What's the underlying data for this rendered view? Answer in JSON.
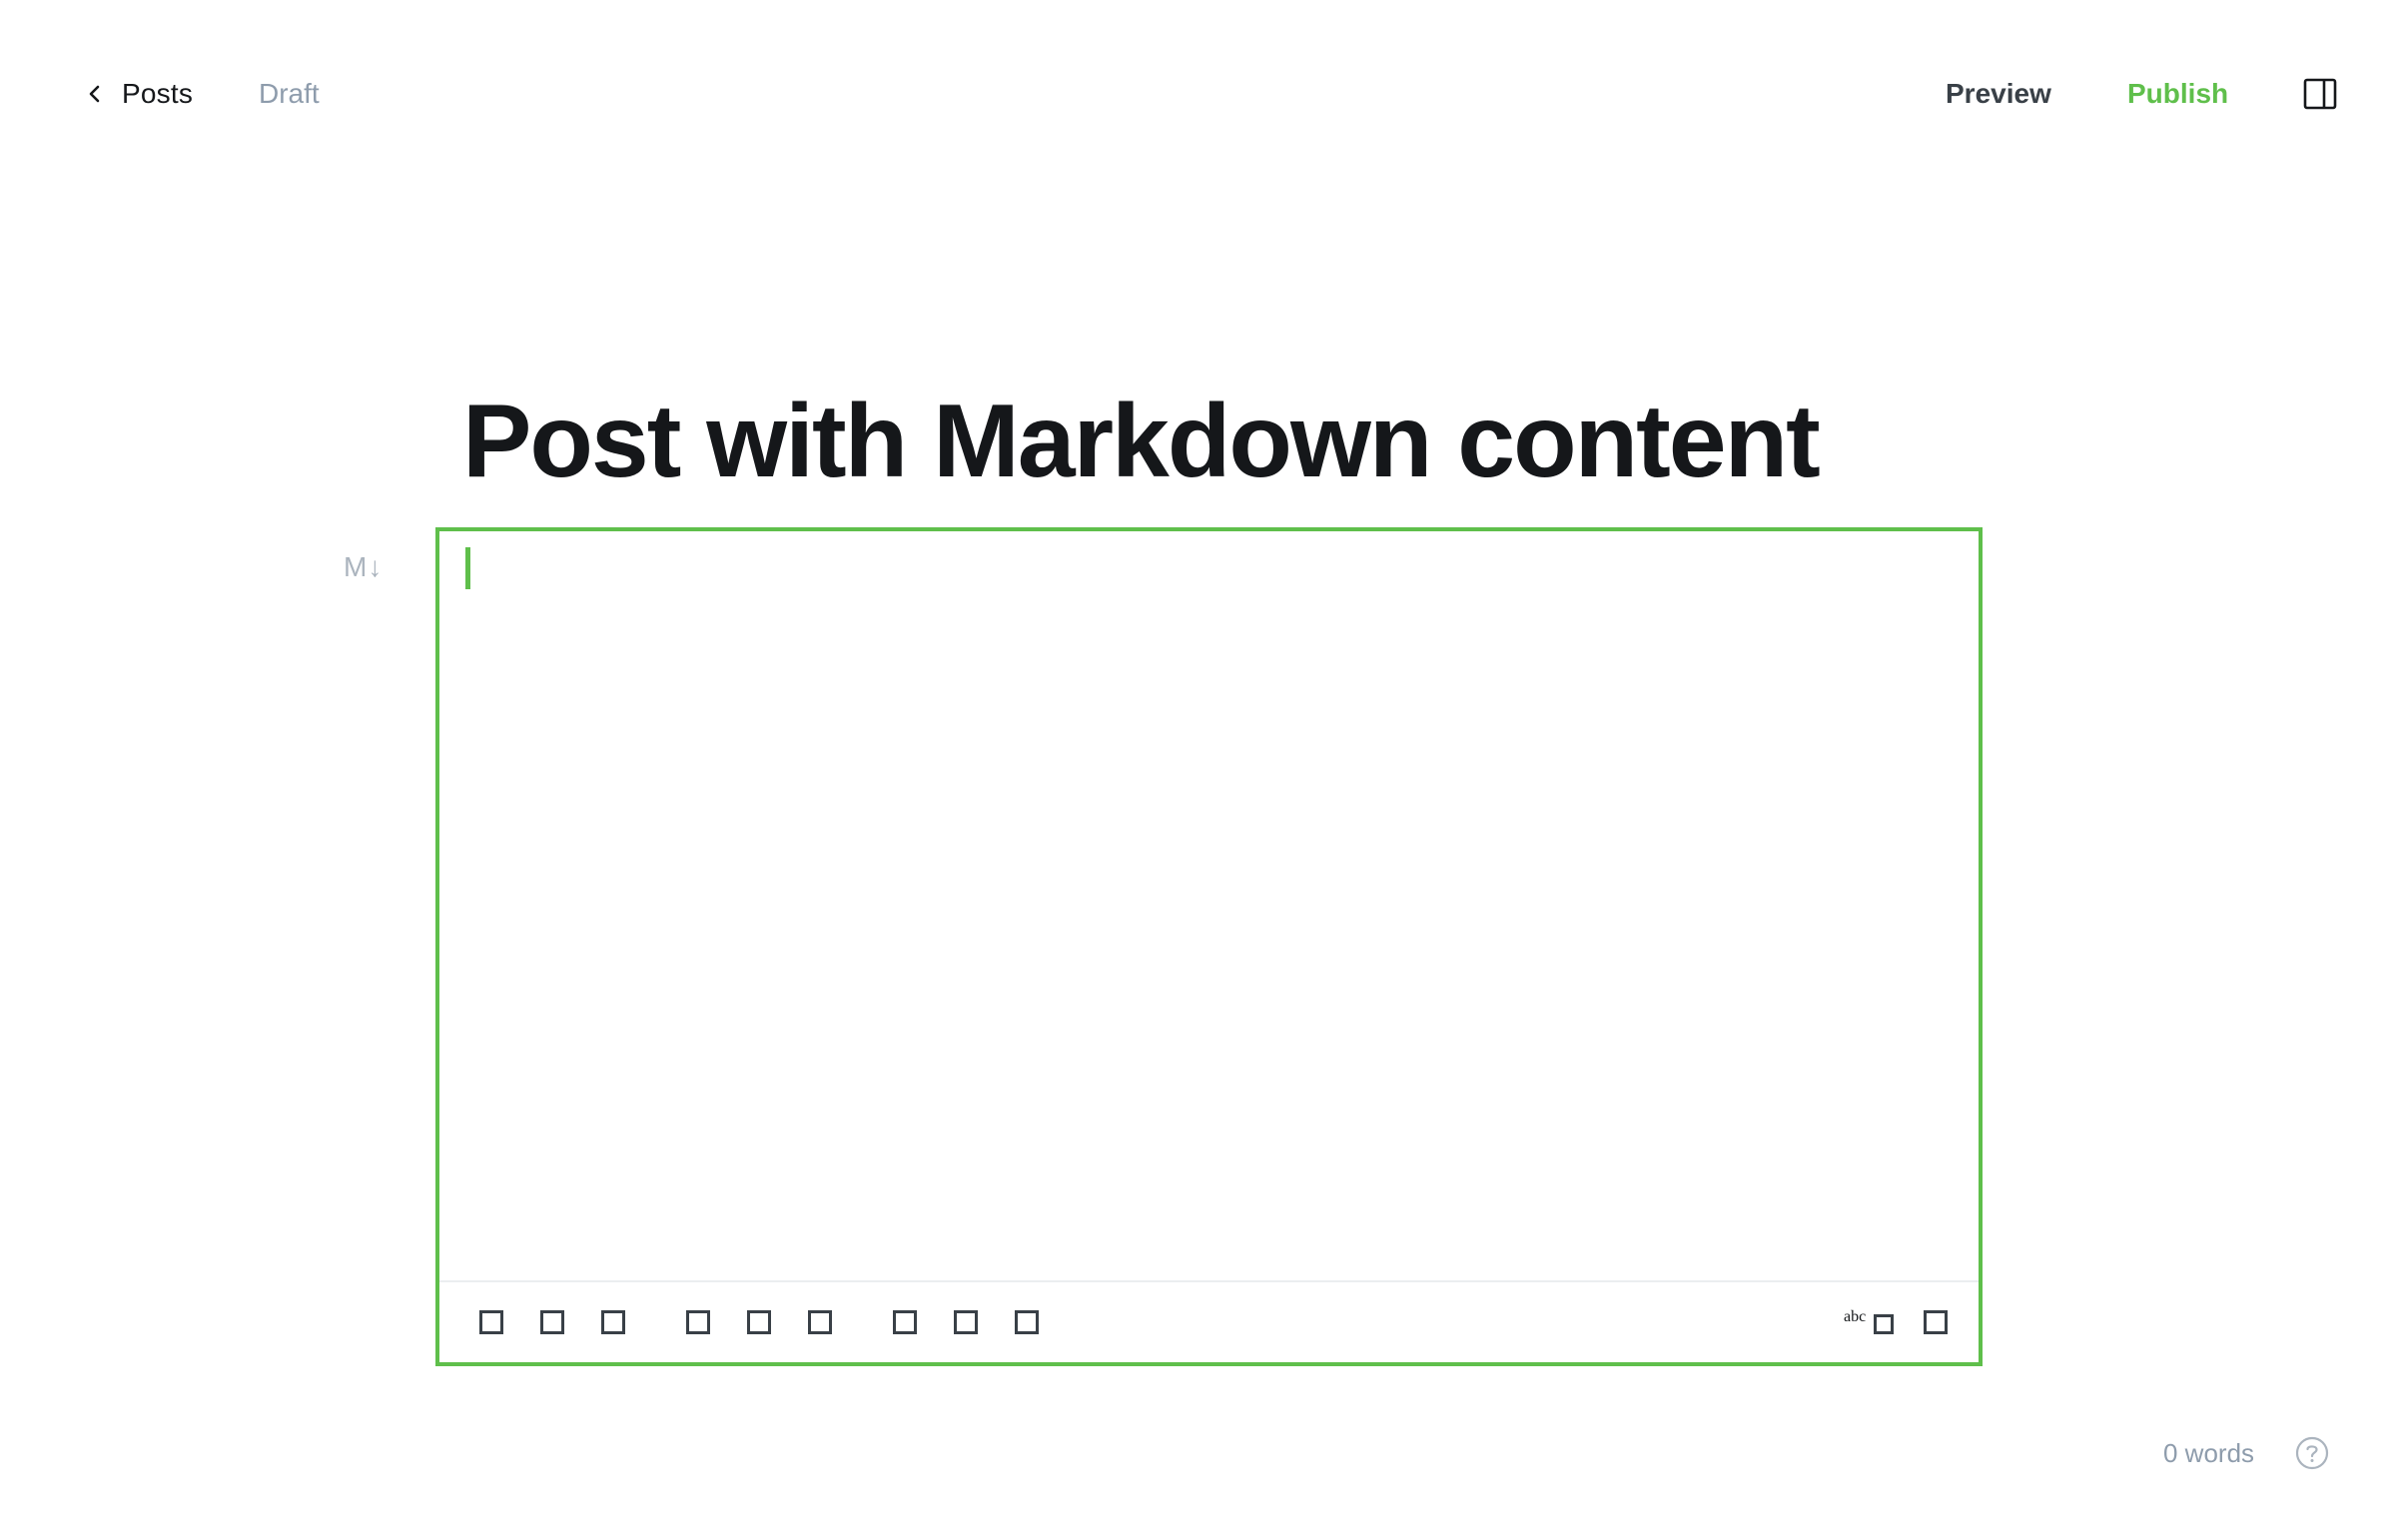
{
  "header": {
    "back_label": "Posts",
    "status": "Draft",
    "preview_label": "Preview",
    "publish_label": "Publish"
  },
  "post": {
    "title": "Post with Markdown content"
  },
  "editor": {
    "mode_badge": "M↓",
    "content": "",
    "toolbar": {
      "buttons": [
        "bold-button",
        "italic-button",
        "heading-button",
        "quote-button",
        "unordered-list-button",
        "ordered-list-button",
        "link-button",
        "image-button",
        "preview-button",
        "spellcheck-button",
        "guide-button"
      ],
      "spellcheck_label": "abc"
    }
  },
  "footer": {
    "word_count": "0 words"
  },
  "colors": {
    "accent": "#5fbf4b",
    "text": "#15171a",
    "muted": "#8e9cac"
  }
}
